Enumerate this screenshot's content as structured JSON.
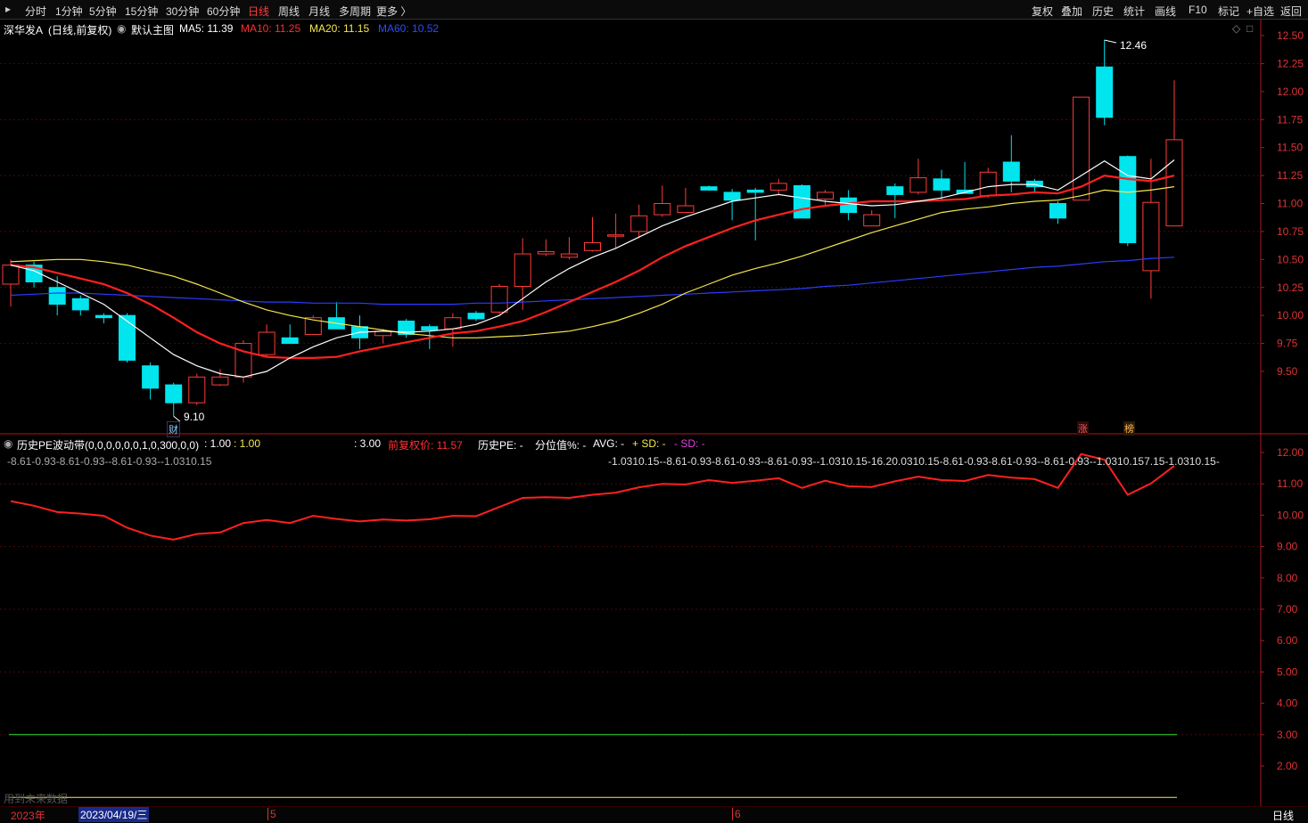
{
  "toolbar": {
    "periods": [
      "分时",
      "1分钟",
      "5分钟",
      "15分钟",
      "30分钟",
      "60分钟",
      "日线",
      "周线",
      "月线",
      "多周期",
      "更多 〉"
    ],
    "active_period": "日线",
    "right_buttons": [
      "复权",
      "叠加",
      "历史",
      "统计",
      "画线",
      "F10",
      "标记",
      "+自选",
      "返回"
    ]
  },
  "title": {
    "stock": "深华发A",
    "mode": "(日线,前复权)",
    "template": "默认主图",
    "ma5": "MA5: 11.39",
    "ma10": "MA10: 11.25",
    "ma20": "MA20: 11.15",
    "ma60": "MA60: 10.52"
  },
  "price_axis": [
    "12.50",
    "12.25",
    "12.00",
    "11.75",
    "11.50",
    "11.25",
    "11.00",
    "10.75",
    "10.50",
    "10.25",
    "10.00",
    "9.75",
    "9.50"
  ],
  "annotations": {
    "high": "12.46",
    "low": "9.10",
    "fin_marker": "财",
    "zhang_marker": "涨",
    "bang_marker": "榜"
  },
  "pe_panel": {
    "title": "历史PE波动带(0,0,0,0,0,0,1,0,300,0,0)",
    "val1": ": 1.00",
    "val2": ": 1.00",
    "val3": ": 3.00",
    "prev_price": "前复权价: 11.57",
    "hist_pe": "历史PE: -",
    "percentile": "分位值%: -",
    "avg": "AVG: -",
    "sd_plus": "+ SD: -",
    "sd_minus": "- SD: -",
    "row_left": "-8.61-0.93-8.61-0.93--8.61-0.93--1.0310.15",
    "row_right": "-1.0310.15--8.61-0.93-8.61-0.93--8.61-0.93--1.0310.15-16.20.0310.15-8.61-0.93-8.61-0.93--8.61-0.93--1.0310.157.15-1.0310.15-",
    "axis": [
      "12.00",
      "11.00",
      "10.00",
      "9.00",
      "8.00",
      "7.00",
      "6.00",
      "5.00",
      "4.00",
      "3.00",
      "2.00"
    ],
    "watermark": "用到未来数据"
  },
  "bottom": {
    "year": "2023年",
    "date": "2023/04/19/三",
    "m5": "5",
    "m6": "6",
    "period": "日线"
  },
  "chart_data": {
    "type": "candlestick",
    "ylim": [
      9.3,
      12.6
    ],
    "candles": [
      {
        "o": 10.28,
        "h": 10.5,
        "l": 10.08,
        "c": 10.45
      },
      {
        "o": 10.45,
        "h": 10.48,
        "l": 10.25,
        "c": 10.3
      },
      {
        "o": 10.25,
        "h": 10.35,
        "l": 10.0,
        "c": 10.1
      },
      {
        "o": 10.15,
        "h": 10.18,
        "l": 10.0,
        "c": 10.05
      },
      {
        "o": 10.0,
        "h": 10.02,
        "l": 9.93,
        "c": 9.98
      },
      {
        "o": 10.0,
        "h": 10.02,
        "l": 9.58,
        "c": 9.6
      },
      {
        "o": 9.55,
        "h": 9.58,
        "l": 9.25,
        "c": 9.35
      },
      {
        "o": 9.38,
        "h": 9.4,
        "l": 9.1,
        "c": 9.22
      },
      {
        "o": 9.22,
        "h": 9.48,
        "l": 9.2,
        "c": 9.45
      },
      {
        "o": 9.38,
        "h": 9.52,
        "l": 9.37,
        "c": 9.45
      },
      {
        "o": 9.45,
        "h": 9.78,
        "l": 9.4,
        "c": 9.75
      },
      {
        "o": 9.65,
        "h": 9.92,
        "l": 9.63,
        "c": 9.85
      },
      {
        "o": 9.8,
        "h": 9.92,
        "l": 9.75,
        "c": 9.75
      },
      {
        "o": 9.83,
        "h": 10.0,
        "l": 9.83,
        "c": 9.98
      },
      {
        "o": 9.98,
        "h": 10.12,
        "l": 9.88,
        "c": 9.88
      },
      {
        "o": 9.9,
        "h": 10.0,
        "l": 9.7,
        "c": 9.8
      },
      {
        "o": 9.82,
        "h": 9.88,
        "l": 9.75,
        "c": 9.86
      },
      {
        "o": 9.95,
        "h": 9.97,
        "l": 9.8,
        "c": 9.83
      },
      {
        "o": 9.9,
        "h": 9.92,
        "l": 9.7,
        "c": 9.87
      },
      {
        "o": 9.88,
        "h": 10.02,
        "l": 9.72,
        "c": 9.98
      },
      {
        "o": 10.02,
        "h": 10.04,
        "l": 9.95,
        "c": 9.97
      },
      {
        "o": 10.03,
        "h": 10.28,
        "l": 10.01,
        "c": 10.26
      },
      {
        "o": 10.26,
        "h": 10.69,
        "l": 10.05,
        "c": 10.55
      },
      {
        "o": 10.55,
        "h": 10.68,
        "l": 10.53,
        "c": 10.57
      },
      {
        "o": 10.52,
        "h": 10.7,
        "l": 10.5,
        "c": 10.55
      },
      {
        "o": 10.58,
        "h": 10.88,
        "l": 10.57,
        "c": 10.65
      },
      {
        "o": 10.72,
        "h": 10.91,
        "l": 10.6,
        "c": 10.72
      },
      {
        "o": 10.75,
        "h": 10.99,
        "l": 10.69,
        "c": 10.89
      },
      {
        "o": 10.9,
        "h": 11.16,
        "l": 10.88,
        "c": 11.0
      },
      {
        "o": 10.92,
        "h": 11.14,
        "l": 10.92,
        "c": 10.98
      },
      {
        "o": 11.15,
        "h": 11.16,
        "l": 11.12,
        "c": 11.12
      },
      {
        "o": 11.1,
        "h": 11.13,
        "l": 10.85,
        "c": 11.03
      },
      {
        "o": 11.12,
        "h": 11.14,
        "l": 10.67,
        "c": 11.1
      },
      {
        "o": 11.12,
        "h": 11.22,
        "l": 11.08,
        "c": 11.18
      },
      {
        "o": 11.16,
        "h": 11.17,
        "l": 10.87,
        "c": 10.87
      },
      {
        "o": 11.04,
        "h": 11.12,
        "l": 10.97,
        "c": 11.1
      },
      {
        "o": 11.05,
        "h": 11.12,
        "l": 10.85,
        "c": 10.92
      },
      {
        "o": 10.8,
        "h": 10.94,
        "l": 10.8,
        "c": 10.9
      },
      {
        "o": 11.15,
        "h": 11.18,
        "l": 10.87,
        "c": 11.08
      },
      {
        "o": 11.1,
        "h": 11.4,
        "l": 11.08,
        "c": 11.23
      },
      {
        "o": 11.22,
        "h": 11.3,
        "l": 11.03,
        "c": 11.12
      },
      {
        "o": 11.12,
        "h": 11.37,
        "l": 11.09,
        "c": 11.09
      },
      {
        "o": 11.07,
        "h": 11.32,
        "l": 11.05,
        "c": 11.28
      },
      {
        "o": 11.37,
        "h": 11.61,
        "l": 11.1,
        "c": 11.2
      },
      {
        "o": 11.2,
        "h": 11.22,
        "l": 11.1,
        "c": 11.15
      },
      {
        "o": 11.0,
        "h": 11.02,
        "l": 10.82,
        "c": 10.87
      },
      {
        "o": 11.03,
        "h": 11.95,
        "l": 11.03,
        "c": 11.95
      },
      {
        "o": 12.22,
        "h": 12.46,
        "l": 11.7,
        "c": 11.77
      },
      {
        "o": 11.42,
        "h": 11.43,
        "l": 10.62,
        "c": 10.65
      },
      {
        "o": 10.4,
        "h": 11.4,
        "l": 10.15,
        "c": 11.01
      },
      {
        "o": 10.8,
        "h": 12.1,
        "l": 10.8,
        "c": 11.57
      }
    ],
    "ma5": [
      10.45,
      10.4,
      10.3,
      10.2,
      10.1,
      9.95,
      9.8,
      9.65,
      9.55,
      9.48,
      9.45,
      9.5,
      9.62,
      9.72,
      9.8,
      9.85,
      9.86,
      9.85,
      9.86,
      9.88,
      9.92,
      10.0,
      10.15,
      10.3,
      10.42,
      10.52,
      10.6,
      10.7,
      10.8,
      10.88,
      10.95,
      11.02,
      11.05,
      11.08,
      11.05,
      11.02,
      11.0,
      10.98,
      10.99,
      11.02,
      11.05,
      11.1,
      11.15,
      11.17,
      11.17,
      11.12,
      11.25,
      11.38,
      11.25,
      11.22,
      11.39
    ],
    "ma10": [
      10.45,
      10.43,
      10.38,
      10.33,
      10.28,
      10.2,
      10.1,
      9.98,
      9.85,
      9.75,
      9.68,
      9.63,
      9.62,
      9.62,
      9.63,
      9.68,
      9.72,
      9.76,
      9.8,
      9.84,
      9.86,
      9.9,
      9.95,
      10.03,
      10.12,
      10.21,
      10.3,
      10.4,
      10.52,
      10.62,
      10.7,
      10.78,
      10.85,
      10.9,
      10.95,
      10.98,
      11.0,
      11.02,
      11.02,
      11.02,
      11.03,
      11.04,
      11.07,
      11.08,
      11.1,
      11.09,
      11.15,
      11.25,
      11.22,
      11.2,
      11.25
    ],
    "ma20": [
      10.48,
      10.49,
      10.5,
      10.5,
      10.48,
      10.45,
      10.4,
      10.35,
      10.28,
      10.2,
      10.12,
      10.05,
      10.0,
      9.96,
      9.93,
      9.9,
      9.87,
      9.84,
      9.82,
      9.8,
      9.8,
      9.81,
      9.82,
      9.84,
      9.86,
      9.9,
      9.95,
      10.02,
      10.1,
      10.2,
      10.28,
      10.36,
      10.42,
      10.47,
      10.53,
      10.6,
      10.67,
      10.74,
      10.8,
      10.86,
      10.92,
      10.95,
      10.97,
      11.0,
      11.02,
      11.03,
      11.07,
      11.12,
      11.1,
      11.12,
      11.15
    ],
    "ma60": [
      10.18,
      10.19,
      10.2,
      10.2,
      10.19,
      10.18,
      10.17,
      10.16,
      10.15,
      10.14,
      10.13,
      10.12,
      10.12,
      10.11,
      10.11,
      10.11,
      10.1,
      10.1,
      10.1,
      10.1,
      10.11,
      10.11,
      10.12,
      10.13,
      10.14,
      10.15,
      10.16,
      10.17,
      10.18,
      10.19,
      10.2,
      10.21,
      10.22,
      10.23,
      10.24,
      10.26,
      10.27,
      10.29,
      10.31,
      10.33,
      10.35,
      10.37,
      10.39,
      10.41,
      10.43,
      10.44,
      10.46,
      10.48,
      10.49,
      10.51,
      10.52
    ],
    "pe_ylim": [
      1.4,
      12.6
    ],
    "pe_series": [
      10.45,
      10.3,
      10.1,
      10.05,
      9.98,
      9.6,
      9.35,
      9.22,
      9.4,
      9.45,
      9.75,
      9.85,
      9.75,
      9.98,
      9.88,
      9.8,
      9.86,
      9.83,
      9.87,
      9.98,
      9.97,
      10.26,
      10.55,
      10.57,
      10.55,
      10.65,
      10.72,
      10.89,
      11.0,
      10.98,
      11.12,
      11.03,
      11.1,
      11.18,
      10.87,
      11.1,
      10.92,
      10.9,
      11.08,
      11.23,
      11.12,
      11.09,
      11.28,
      11.2,
      11.15,
      10.87,
      11.95,
      11.77,
      10.65,
      11.01,
      11.57
    ],
    "green_line": 3.0,
    "yellow_line": 1.0
  }
}
